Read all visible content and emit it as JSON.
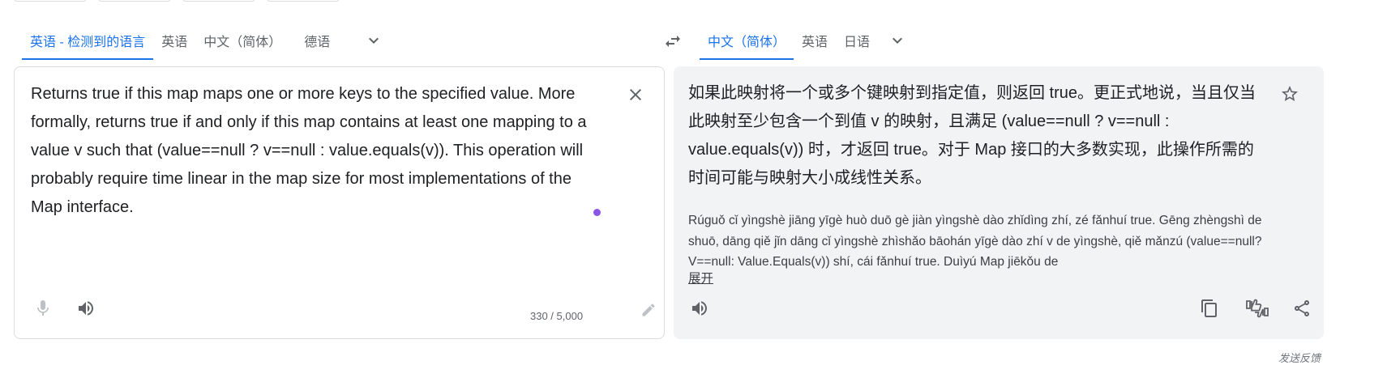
{
  "source_languages": {
    "tabs": [
      {
        "label": "英语 - 检测到的语言",
        "active": true
      },
      {
        "label": "英语",
        "active": false
      },
      {
        "label": "中文（简体）",
        "active": false
      },
      {
        "label": "德语",
        "active": false
      }
    ],
    "more_icon": "chevron-down-icon"
  },
  "target_languages": {
    "tabs": [
      {
        "label": "中文（简体）",
        "active": true
      },
      {
        "label": "英语",
        "active": false
      },
      {
        "label": "日语",
        "active": false
      }
    ],
    "more_icon": "chevron-down-icon"
  },
  "swap_icon": "swap-horiz-icon",
  "source": {
    "text": "Returns true if this map maps one or more keys to the specified value. More formally, returns true if and only if this map contains at least one mapping to a value v such that (value==null ? v==null : value.equals(v)). This operation will probably require time linear in the map size for most implementations of the Map interface.",
    "char_count": "330 / 5,000",
    "icons": {
      "clear": "close-icon",
      "mic": "mic-icon",
      "listen": "speaker-icon",
      "handwrite": "pencil-icon"
    }
  },
  "target": {
    "text": "如果此映射将一个或多个键映射到指定值，则返回 true。更正式地说，当且仅当此映射至少包含一个到值 v 的映射，且满足 (value==null ? v==null : value.equals(v)) 时，才返回 true。对于 Map 接口的大多数实现，此操作所需的时间可能与映射大小成线性关系。",
    "romanization": "Rúguǒ cǐ yìngshè jiāng yīgè huò duō gè jiàn yìngshè dào zhǐdìng zhí, zé fǎnhuí true. Gēng zhèngshì de shuō, dāng qiě jǐn dāng cǐ yìngshè zhìshǎo bāohán yīgè dào zhí v de yìngshè, qiě mǎnzú (value==null? V==null: Value.Equals(v)) shí, cái fǎnhuí true. Duìyú Map jiēkǒu de",
    "expand_label": "展开",
    "icons": {
      "star": "star-icon",
      "listen": "speaker-icon",
      "copy": "copy-icon",
      "rate": "thumbs-rate-icon",
      "share": "share-icon"
    }
  },
  "feedback_label": "发送反馈",
  "colors": {
    "accent": "#1a73e8",
    "panel_bg": "#f1f3f4",
    "text": "#202124",
    "secondary": "#5f6368"
  }
}
